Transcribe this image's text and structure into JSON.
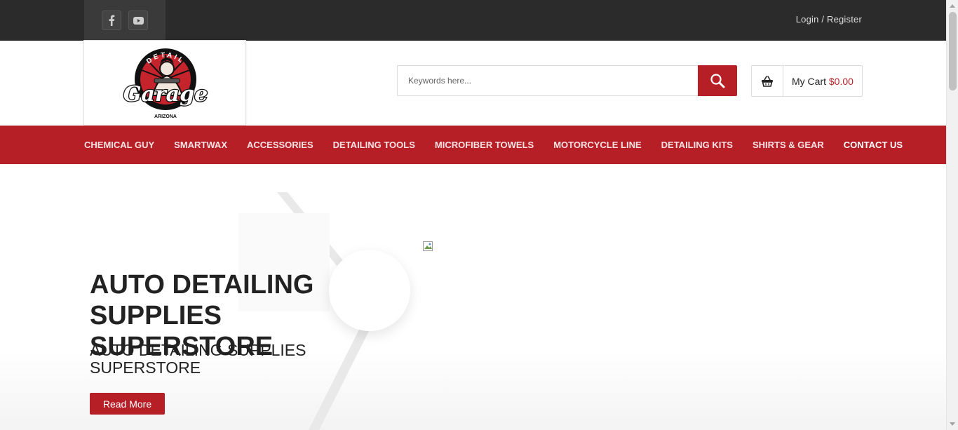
{
  "topbar": {
    "social": [
      {
        "icon": "facebook-icon"
      },
      {
        "icon": "youtube-icon"
      }
    ],
    "login_label": "Login",
    "separator": " / ",
    "register_label": "Register"
  },
  "logo": {
    "top_text": "DETAIL",
    "script_text": "Garage",
    "bottom_text": "ARIZONA"
  },
  "search": {
    "placeholder": "Keywords here...",
    "value": "",
    "button_icon": "search-icon"
  },
  "cart": {
    "icon": "basket-icon",
    "label": "My Cart",
    "amount": "$0.00"
  },
  "nav": {
    "items": [
      {
        "label": "CHEMICAL GUY"
      },
      {
        "label": "SMARTWAX"
      },
      {
        "label": "ACCESSORIES"
      },
      {
        "label": "DETAILING TOOLS"
      },
      {
        "label": "MICROFIBER TOWELS"
      },
      {
        "label": "MOTORCYCLE LINE"
      },
      {
        "label": "DETAILING KITS"
      },
      {
        "label": "SHIRTS & GEAR"
      },
      {
        "label": "CONTACT US"
      }
    ]
  },
  "hero": {
    "title": "AUTO DETAILING SUPPLIES SUPERSTORE",
    "subtitle": "AUTO DETAILING SUPPLIES SUPERSTORE",
    "button_label": "Read More"
  },
  "colors": {
    "brand_red": "#b71f27",
    "topbar": "#2b2b2b"
  }
}
